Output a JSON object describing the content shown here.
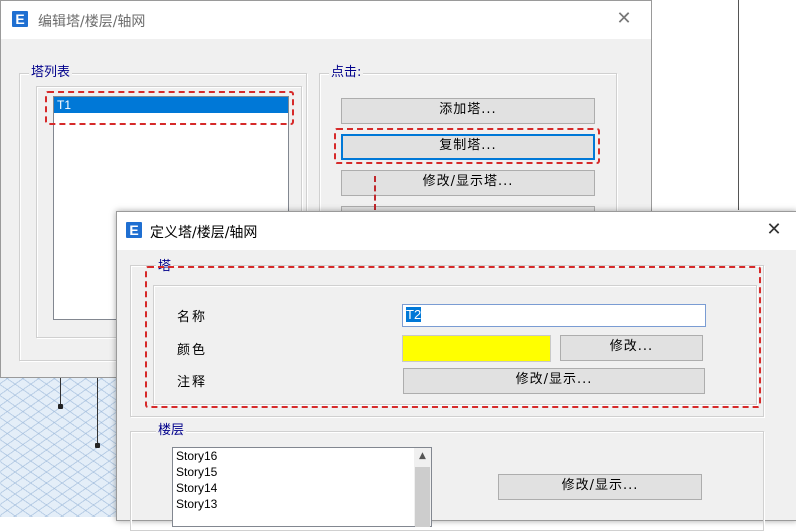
{
  "dialog_edit": {
    "title": "编辑塔/楼层/轴网",
    "tower_list": {
      "label": "塔列表",
      "items": [
        "T1"
      ],
      "selected": "T1"
    },
    "click_group": {
      "label": "点击:",
      "add_tower": "添加塔...",
      "copy_tower": "复制塔...",
      "modify_tower": "修改/显示塔..."
    },
    "close_icon": "close-icon"
  },
  "dialog_define": {
    "title": "定义塔/楼层/轴网",
    "tower_group": {
      "label": "塔",
      "name_label": "名称",
      "name_value": "T2",
      "color_label": "颜色",
      "color_value": "#ffff00",
      "color_modify": "修改...",
      "note_label": "注释",
      "note_modify": "修改/显示..."
    },
    "story_group": {
      "label": "楼层",
      "stories": [
        "Story16",
        "Story15",
        "Story14",
        "Story13"
      ],
      "modify": "修改/显示..."
    },
    "close_icon": "close-icon"
  },
  "colors": {
    "accent": "#0078d7",
    "annotation": "#d62a2a",
    "group_label": "#00008b"
  }
}
